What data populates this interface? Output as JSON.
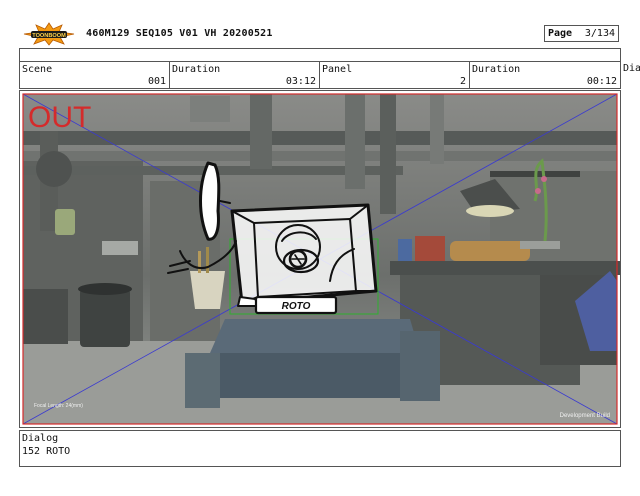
{
  "header": {
    "logo_text": "TOONBOOM",
    "title": "460M129 SEQ105 V01 VH 20200521",
    "page_label": "Page",
    "page_value": "3/134"
  },
  "info": {
    "scene_label": "Scene",
    "scene_value": "001",
    "duration_label": "Duration",
    "duration_value": "03:12",
    "panel_label": "Panel",
    "panel_value": "2",
    "duration2_label": "Duration",
    "duration2_value": "00:12",
    "cut_label": "Dia"
  },
  "panel": {
    "overlay_text": "OUT",
    "focal_text": "Focal Length: 24(mm)",
    "build_text": "Development Build",
    "sign_text": "ROTO"
  },
  "dialog": {
    "label": "Dialog",
    "text": "152 ROTO"
  },
  "colors": {
    "accent_red": "#d42b2b",
    "guide_blue": "#3a3ad0",
    "field_green": "#2fb02f",
    "logo_orange": "#f39a14"
  }
}
